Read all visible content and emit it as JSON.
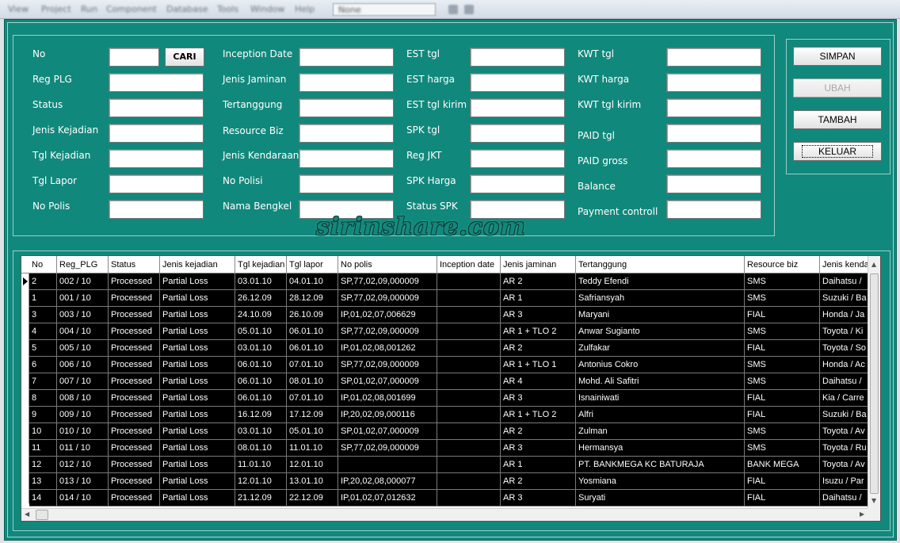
{
  "menu": {
    "items": [
      "View",
      "Project",
      "Run",
      "Component",
      "Database",
      "Tools",
      "Window",
      "Help"
    ],
    "combo_value": "None"
  },
  "form": {
    "col1": [
      {
        "label": "No",
        "value": ""
      },
      {
        "label": "Reg PLG",
        "value": ""
      },
      {
        "label": "Status",
        "value": ""
      },
      {
        "label": "Jenis Kejadian",
        "value": ""
      },
      {
        "label": "Tgl Kejadian",
        "value": ""
      },
      {
        "label": "Tgl Lapor",
        "value": ""
      },
      {
        "label": "No Polis",
        "value": ""
      }
    ],
    "cari_label": "CARI",
    "col2": [
      {
        "label": "Inception Date",
        "value": ""
      },
      {
        "label": "Jenis Jaminan",
        "value": ""
      },
      {
        "label": "Tertanggung",
        "value": ""
      },
      {
        "label": "Resource Biz",
        "value": ""
      },
      {
        "label": "Jenis Kendaraan",
        "value": ""
      },
      {
        "label": "No Polisi",
        "value": ""
      },
      {
        "label": "Nama Bengkel",
        "value": ""
      }
    ],
    "col3": [
      {
        "label": "EST tgl",
        "value": ""
      },
      {
        "label": "EST harga",
        "value": ""
      },
      {
        "label": "EST tgl kirim",
        "value": ""
      },
      {
        "label": "SPK tgl",
        "value": ""
      },
      {
        "label": "Reg JKT",
        "value": ""
      },
      {
        "label": "SPK Harga",
        "value": ""
      },
      {
        "label": "Status SPK",
        "value": ""
      }
    ],
    "col4": [
      {
        "label": "KWT tgl",
        "value": ""
      },
      {
        "label": "KWT harga",
        "value": ""
      },
      {
        "label": "KWT tgl kirim",
        "value": ""
      },
      {
        "label": "PAID tgl",
        "value": ""
      },
      {
        "label": "PAID gross",
        "value": ""
      },
      {
        "label": "Balance",
        "value": ""
      },
      {
        "label": "Payment controll",
        "value": ""
      }
    ]
  },
  "buttons": {
    "simpan": "SIMPAN",
    "ubah": "UBAH",
    "tambah": "TAMBAH",
    "keluar": "KELUAR"
  },
  "watermark": "sirinshare.com",
  "grid": {
    "columns": [
      "No",
      "Reg_PLG",
      "Status",
      "Jenis kejadian",
      "Tgl kejadian",
      "Tgl lapor",
      "No polis",
      "Inception date",
      "Jenis jaminan",
      "Tertanggung",
      "Resource biz",
      "Jenis kenda"
    ],
    "rows": [
      [
        "2",
        "002 / 10",
        "Processed",
        "Partial Loss",
        "03.01.10",
        "04.01.10",
        "SP,77,02,09,000009",
        "",
        "AR 2",
        "Teddy Efendi",
        "SMS",
        "Daihatsu /"
      ],
      [
        "1",
        "001 / 10",
        "Processed",
        "Partial Loss",
        "26.12.09",
        "28.12.09",
        "SP,77,02,09,000009",
        "",
        "AR 1",
        "Safriansyah",
        "SMS",
        "Suzuki / Ba"
      ],
      [
        "3",
        "003 / 10",
        "Processed",
        "Partial Loss",
        "24.10.09",
        "26.10.09",
        "IP,01,02,07,006629",
        "",
        "AR 3",
        "Maryani",
        "FIAL",
        "Honda / Ja"
      ],
      [
        "4",
        "004 / 10",
        "Processed",
        "Partial Loss",
        "05.01.10",
        "06.01.10",
        "SP,77,02,09,000009",
        "",
        "AR 1 + TLO 2",
        "Anwar Sugianto",
        "SMS",
        "Toyota / Ki"
      ],
      [
        "5",
        "005 / 10",
        "Processed",
        "Partial Loss",
        "03.01.10",
        "06.01.10",
        "IP,01,02,08,001262",
        "",
        "AR 2",
        "Zulfakar",
        "FIAL",
        "Toyota / So"
      ],
      [
        "6",
        "006 / 10",
        "Processed",
        "Partial Loss",
        "06.01.10",
        "07.01.10",
        "SP,77,02,09,000009",
        "",
        "AR 1 + TLO 1",
        "Antonius Cokro",
        "SMS",
        "Honda / Ac"
      ],
      [
        "7",
        "007 / 10",
        "Processed",
        "Partial Loss",
        "06.01.10",
        "08.01.10",
        "SP,01,02,07,000009",
        "",
        "AR 4",
        "Mohd. Ali Safitri",
        "SMS",
        "Daihatsu /"
      ],
      [
        "8",
        "008 / 10",
        "Processed",
        "Partial Loss",
        "06.01.10",
        "07.01.10",
        "IP,01,02,08,001699",
        "",
        "AR 3",
        "Isnainiwati",
        "FIAL",
        "Kia / Carre"
      ],
      [
        "9",
        "009 / 10",
        "Processed",
        "Partial Loss",
        "16.12.09",
        "17.12.09",
        "IP,20,02,09,000116",
        "",
        "AR 1 + TLO 2",
        "Alfri",
        "FIAL",
        "Suzuki / Ba"
      ],
      [
        "10",
        "010 / 10",
        "Processed",
        "Partial Loss",
        "03.01.10",
        "05.01.10",
        "SP,01,02,07,000009",
        "",
        "AR 2",
        "Zulman",
        "SMS",
        "Toyota / Av"
      ],
      [
        "11",
        "011 / 10",
        "Processed",
        "Partial Loss",
        "08.01.10",
        "11.01.10",
        "SP,77,02,09,000009",
        "",
        "AR 3",
        "Hermansya",
        "SMS",
        "Toyota / Ru"
      ],
      [
        "12",
        "012 / 10",
        "Processed",
        "Partial Loss",
        "11.01.10",
        "12.01.10",
        "",
        "",
        "AR 1",
        "PT. BANKMEGA KC BATURAJA",
        "BANK MEGA",
        "Toyota / Av"
      ],
      [
        "13",
        "013 / 10",
        "Processed",
        "Partial Loss",
        "12.01.10",
        "13.01.10",
        "IP,20,02,08,000077",
        "",
        "AR 2",
        "Yosmiana",
        "FIAL",
        "Isuzu / Par"
      ],
      [
        "14",
        "014 / 10",
        "Processed",
        "Partial Loss",
        "21.12.09",
        "22.12.09",
        "IP,01,02,07,012632",
        "",
        "AR 3",
        "Suryati",
        "FIAL",
        "Daihatsu /"
      ]
    ]
  }
}
